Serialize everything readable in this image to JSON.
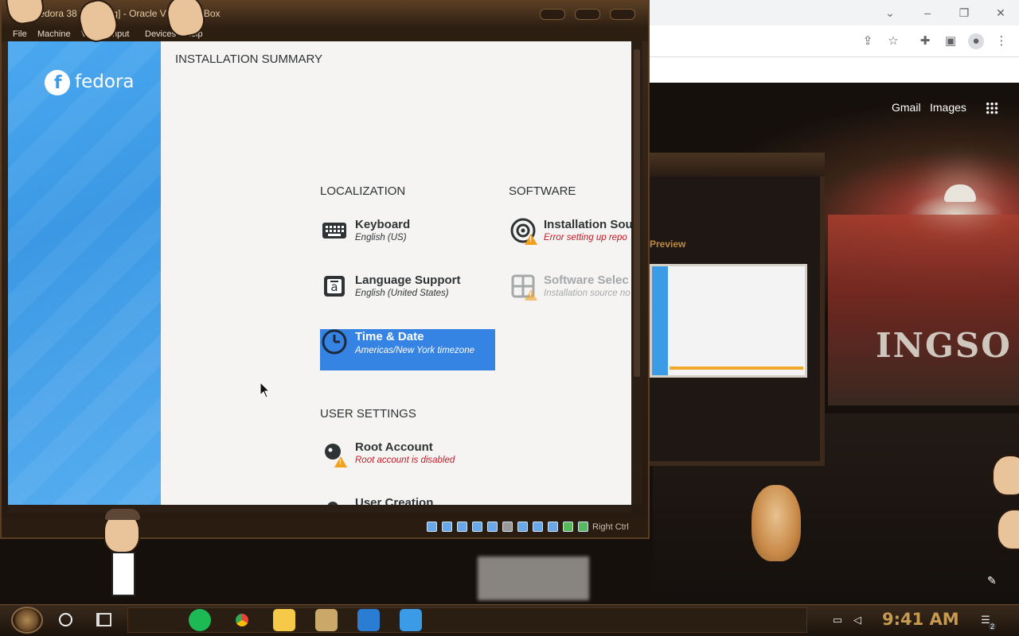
{
  "vbox": {
    "title": "Fedora 38 [Running] - Oracle VM VirtualBox",
    "menu": [
      "File",
      "Machine",
      "View",
      "Input",
      "Devices",
      "Help"
    ],
    "host_key": "Right Ctrl"
  },
  "installer": {
    "brand": "fedora",
    "title": "INSTALLATION SUMMARY",
    "sections": {
      "localization": "LOCALIZATION",
      "software": "SOFTWARE",
      "user_settings": "USER SETTINGS"
    },
    "spokes": {
      "keyboard": {
        "name": "Keyboard",
        "status": "English (US)",
        "icon": "keyboard-icon"
      },
      "language": {
        "name": "Language Support",
        "status": "English (United States)",
        "icon": "language-icon"
      },
      "time": {
        "name": "Time & Date",
        "status": "Americas/New York timezone",
        "icon": "clock-icon"
      },
      "source": {
        "name": "Installation Sou",
        "status": "Error setting up repo",
        "icon": "disc-icon"
      },
      "software": {
        "name": "Software Selec",
        "status": "Installation source no",
        "icon": "package-icon"
      },
      "root": {
        "name": "Root Account",
        "status": "Root account is disabled",
        "icon": "user-icon"
      },
      "user": {
        "name": "User Creation",
        "icon": "user-icon"
      }
    }
  },
  "chrome": {
    "links": {
      "gmail": "Gmail",
      "images": "Images"
    }
  },
  "bg_window": {
    "preview_label": "Preview"
  },
  "wallpaper": {
    "sign_text": "INGSO"
  },
  "taskbar": {
    "clock": "9:41 AM",
    "notification_count": "2",
    "apps": [
      "spotify-icon",
      "chrome-icon",
      "file-explorer-icon",
      "app-icon",
      "virtualbox-icon",
      "app-icon"
    ]
  },
  "colors": {
    "fedora_blue": "#3c9be6",
    "selected_spoke": "#3584e4",
    "error_red": "#c01c28",
    "warning_orange": "#f29f1b",
    "clock_gold": "#c79a52"
  }
}
